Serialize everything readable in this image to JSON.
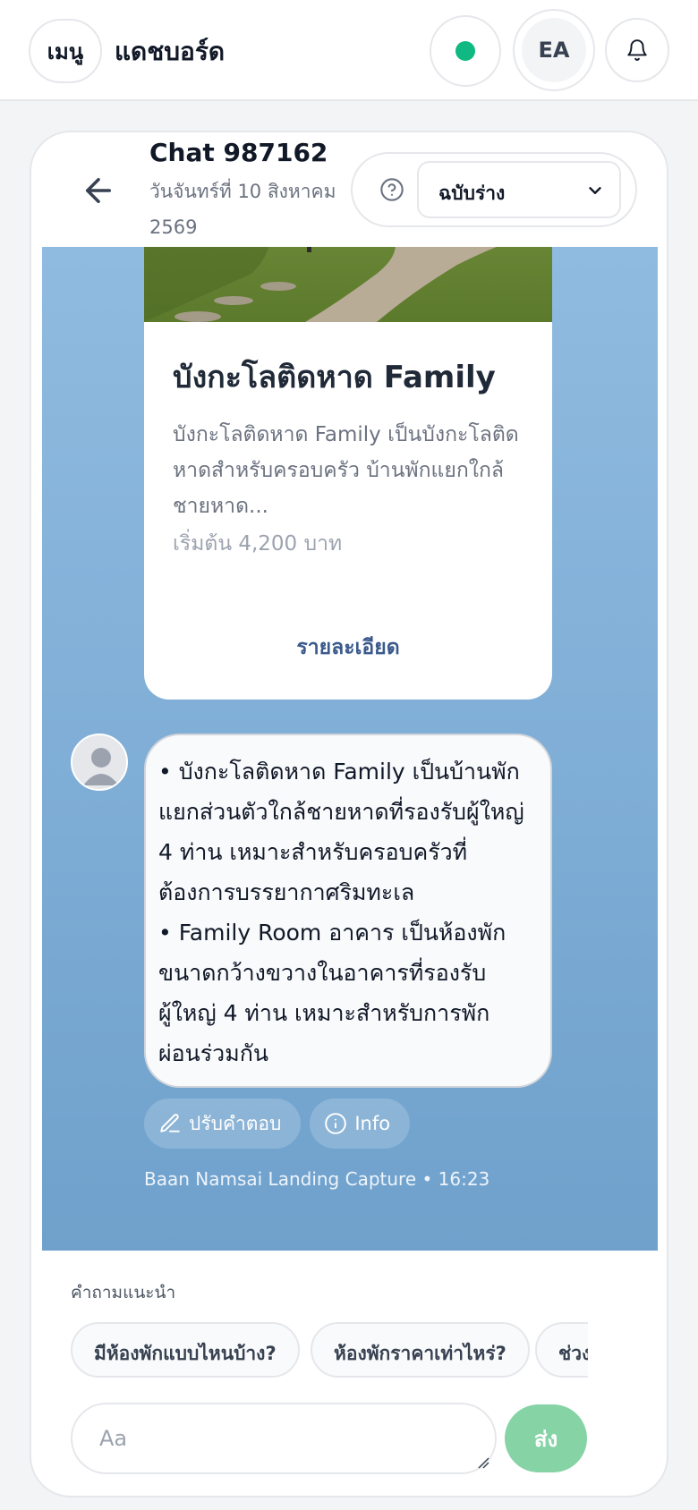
{
  "topbar": {
    "menu_label": "เมนู",
    "title": "แดชบอร์ด",
    "avatar_initials": "EA",
    "status_color": "#10b981"
  },
  "chat": {
    "name": "Chat 987162",
    "date": "วันจันทร์ที่ 10 สิงหาคม 2569",
    "status_select": "ฉบับร่าง"
  },
  "card": {
    "title": "บังกะโลติดหาด Family",
    "description": "บังกะโลติดหาด Family เป็นบังกะโลติดหาดสำหรับครอบครัว บ้านพักแยกใกล้ชายหาด...",
    "price": "เริ่มต้น 4,200 บาท",
    "link": "รายละเอียด"
  },
  "message": {
    "lines": [
      "• บังกะโลติดหาด Family เป็นบ้านพัก",
      "แยกส่วนตัวใกล้ชายหาดที่รองรับผู้ใหญ่",
      "4 ท่าน เหมาะสำหรับครอบครัวที่",
      "ต้องการบรรยากาศริมทะเล",
      "• Family Room อาคาร เป็นห้องพัก",
      "ขนาดกว้างขวางในอาคารที่รองรับ",
      "ผู้ใหญ่ 4 ท่าน เหมาะสำหรับการพัก",
      "ผ่อนร่วมกัน"
    ],
    "edit_label": "ปรับคำตอบ",
    "info_label": "Info",
    "meta": "Baan Namsai Landing Capture • 16:23"
  },
  "suggestions": {
    "label": "คำถามแนะนำ",
    "items": [
      "มีห้องพักแบบไหนบ้าง?",
      "ห้องพักราคาเท่าไหร่?",
      "ช่วงเวลาเช็คอิน?"
    ]
  },
  "composer": {
    "placeholder": "Aa",
    "send_label": "ส่ง"
  }
}
